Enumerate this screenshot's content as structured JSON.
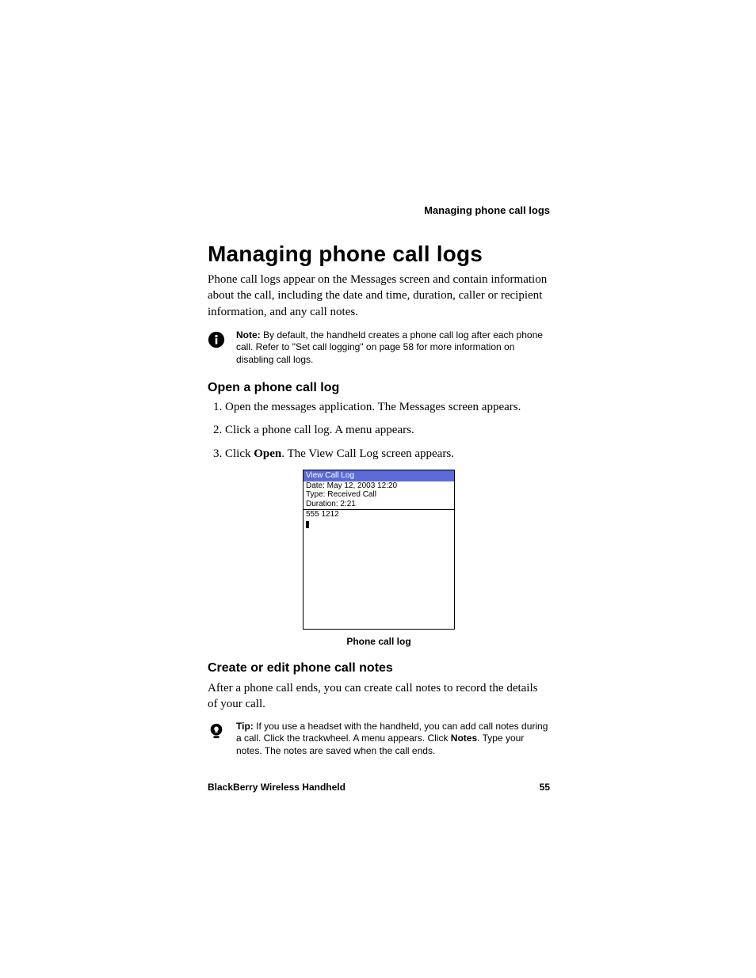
{
  "running_head": "Managing phone call logs",
  "title": "Managing phone call logs",
  "intro": "Phone call logs appear on the Messages screen and contain information about the call, including the date and time, duration, caller or recipient information, and any call notes.",
  "note": {
    "label": "Note:",
    "text": " By default, the handheld creates a phone call log after each phone call. Refer to \"Set call logging\" on page 58 for more information on disabling call logs."
  },
  "section1": {
    "heading": "Open a phone call log",
    "steps": [
      "Open the messages application. The Messages screen appears.",
      "Click a phone call log. A menu appears."
    ],
    "step3_prefix": "Click ",
    "step3_bold": "Open",
    "step3_suffix": ". The View Call Log screen appears."
  },
  "screenshot": {
    "title": "View Call Log",
    "line1": "Date: May 12, 2003 12:20",
    "line2": "Type: Received Call",
    "line3": "Duration: 2:21",
    "number": "555 1212",
    "caption": "Phone call log"
  },
  "section2": {
    "heading": "Create or edit phone call notes",
    "body": "After a phone call ends, you can create call notes to record the details of your call."
  },
  "tip": {
    "label": "Tip:",
    "t1": " If you use a headset with the handheld, you can add call notes during a call. Click the trackwheel. A menu appears. Click ",
    "bold": "Notes",
    "t2": ". Type your notes. The notes are saved when the call ends."
  },
  "footer": {
    "product": "BlackBerry Wireless Handheld",
    "page": "55"
  }
}
